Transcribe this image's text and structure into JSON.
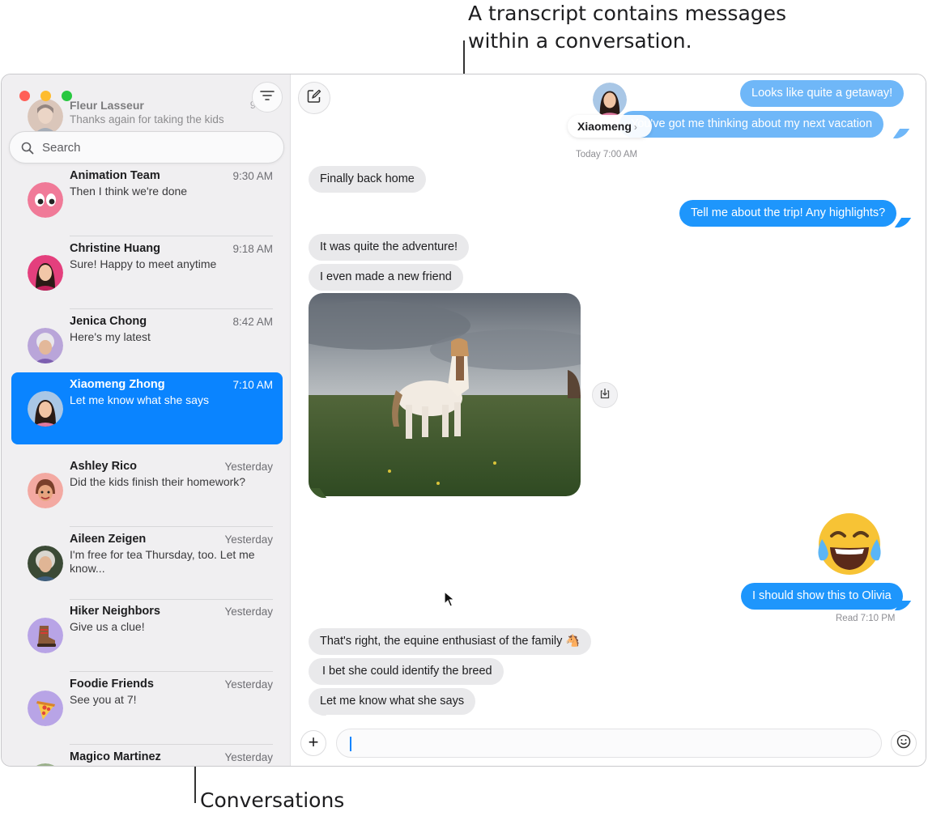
{
  "callouts": {
    "transcript": [
      "A transcript contains messages",
      "within a conversation."
    ],
    "conversations": "Conversations"
  },
  "window": {
    "controls": [
      "close",
      "minimize",
      "maximize"
    ]
  },
  "sidebar": {
    "filter_icon": "filter-lines-icon",
    "pinned": {
      "name": "Fleur Lasseur",
      "time": "9:41",
      "preview": "Thanks again for taking the kids"
    },
    "search": {
      "placeholder": "Search",
      "icon": "search-icon"
    },
    "conversations": [
      {
        "name": "Animation Team",
        "time": "9:30 AM",
        "preview": "Then I think we're done",
        "avatar": "eyes-emoji"
      },
      {
        "name": "Christine Huang",
        "time": "9:18 AM",
        "preview": "Sure! Happy to meet anytime",
        "avatar": "photo"
      },
      {
        "name": "Jenica Chong",
        "time": "8:42 AM",
        "preview": "Here's my latest",
        "avatar": "memoji"
      },
      {
        "name": "Xiaomeng Zhong",
        "time": "7:10 AM",
        "preview": "Let me know what she says",
        "avatar": "photo",
        "selected": true
      },
      {
        "name": "Ashley Rico",
        "time": "Yesterday",
        "preview": "Did the kids finish their homework?",
        "avatar": "memoji"
      },
      {
        "name": "Aileen Zeigen",
        "time": "Yesterday",
        "preview": "I'm free for tea Thursday, too. Let me know...",
        "avatar": "photo"
      },
      {
        "name": "Hiker Neighbors",
        "time": "Yesterday",
        "preview": "Give us a clue!",
        "avatar": "boot-emoji"
      },
      {
        "name": "Foodie Friends",
        "time": "Yesterday",
        "preview": "See you at 7!",
        "avatar": "pizza-emoji"
      },
      {
        "name": "Magico Martinez",
        "time": "Yesterday",
        "preview": "",
        "avatar": "photo"
      }
    ]
  },
  "transcript": {
    "contact_name": "Xiaomeng",
    "compose_icon": "compose-icon",
    "timestamp": "Today 7:00 AM",
    "messages": [
      {
        "from": "me",
        "text": "Looks like quite a getaway!"
      },
      {
        "from": "me",
        "text": "You've got me thinking about my next vacation"
      },
      {
        "from": "them",
        "text": "Finally back home"
      },
      {
        "from": "me",
        "text": "Tell me about the trip! Any highlights?"
      },
      {
        "from": "them",
        "text": "It was quite the adventure!"
      },
      {
        "from": "them",
        "text": "I even made a new friend"
      },
      {
        "from": "them",
        "type": "photo",
        "description": "horse-photo"
      },
      {
        "from": "me",
        "type": "emoji",
        "text": "face-with-tears-of-joy"
      },
      {
        "from": "me",
        "text": "I should show this to Olivia"
      },
      {
        "from": "them",
        "text": "That's right, the equine enthusiast of the family 🐴"
      },
      {
        "from": "them",
        "text": "I bet she could identify the breed"
      },
      {
        "from": "them",
        "text": "Let me know what she says"
      }
    ],
    "read_receipt": "Read 7:10 PM",
    "input": {
      "value": "",
      "placeholder": ""
    }
  },
  "colors": {
    "accent": "#0a84ff",
    "outgoing": "#1e96fc",
    "incoming": "#e9e9eb"
  }
}
